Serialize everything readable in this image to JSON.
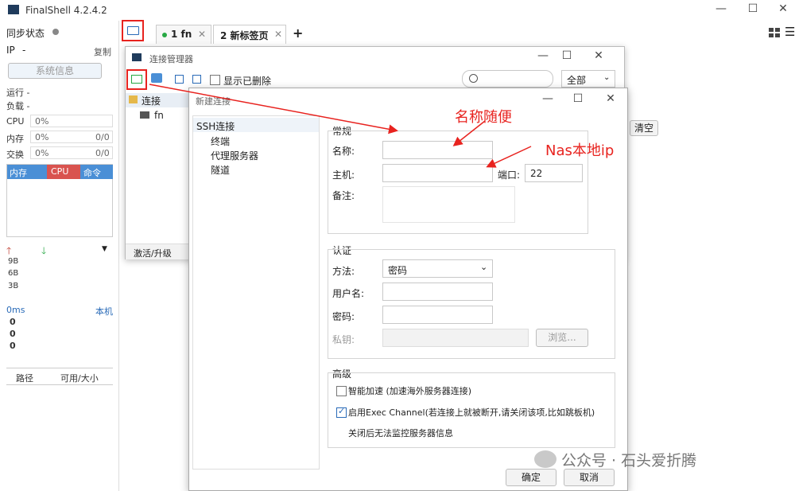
{
  "app": {
    "title": "FinalShell 4.2.4.2",
    "sync_label": "同步状态",
    "ip_label": "IP",
    "ip_value": "-",
    "copy_label": "复制",
    "sysinfo_button": "系统信息",
    "run_label": "运行 -",
    "load_label": "负载 -",
    "cpu_label": "CPU",
    "cpu_value": "0%",
    "mem_label": "内存",
    "mem_value": "0%",
    "mem_ratio": "0/0",
    "swap_label": "交换",
    "swap_value": "0%",
    "swap_ratio": "0/0",
    "proc_tabs": [
      "内存",
      "CPU",
      "命令"
    ],
    "net_ticks": [
      "9B",
      "6B",
      "3B"
    ],
    "latency_label": "0ms",
    "latency_target": "本机",
    "latency_values": [
      "0",
      "0",
      "0"
    ],
    "disk_headers": [
      "路径",
      "可用/大小"
    ]
  },
  "tabs": [
    {
      "label": "1 fn"
    },
    {
      "label": "2 新标签页"
    }
  ],
  "conn_manager": {
    "title": "连接管理器",
    "show_deleted": "显示已删除",
    "filter_value": "全部",
    "tree_root": "连接",
    "tree_child": "fn",
    "activate": "激活/升级",
    "clear_button": "清空"
  },
  "new_conn": {
    "title": "新建连接",
    "nav": [
      "SSH连接",
      "终端",
      "代理服务器",
      "隧道"
    ],
    "general_group": "常规",
    "name_label": "名称:",
    "host_label": "主机:",
    "port_label": "端口:",
    "port_value": "22",
    "note_label": "备注:",
    "auth_group": "认证",
    "method_label": "方法:",
    "method_value": "密码",
    "user_label": "用户名:",
    "pass_label": "密码:",
    "key_label": "私钥:",
    "browse_button": "浏览...",
    "advanced_group": "高级",
    "smart_accel": "智能加速 (加速海外服务器连接)",
    "exec_channel": "启用Exec Channel(若连接上就被断开,请关闭该项,比如跳板机)",
    "exec_note": "关闭后无法监控服务器信息",
    "ok_button": "确定",
    "cancel_button": "取消"
  },
  "annotations": {
    "name_hint": "名称随便",
    "host_hint": "Nas本地ip"
  },
  "watermark": "公众号 · 石头爱折腾",
  "colors": {
    "annotation_red": "#e8231f",
    "cpu_tab_red": "#d9534f",
    "tab_blue": "#4a8fd6",
    "status_green": "#27a844"
  }
}
